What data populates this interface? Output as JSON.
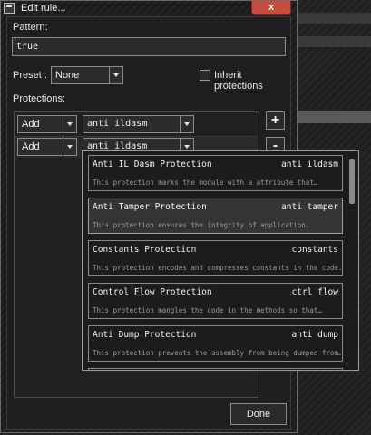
{
  "window": {
    "title": "Edit rule...",
    "close_glyph": "x"
  },
  "pattern": {
    "label": "Pattern:",
    "value": "true"
  },
  "preset": {
    "label": "Preset :",
    "value": "None"
  },
  "inherit": {
    "label": "Inherit protections",
    "checked": false
  },
  "protections": {
    "label": "Protections:",
    "rows": [
      {
        "action": "Add",
        "protection": "anti ildasm"
      },
      {
        "action": "Add",
        "protection": "anti ildasm"
      }
    ],
    "add_glyph": "+",
    "remove_glyph": "-"
  },
  "dropdown": {
    "items": [
      {
        "name": "Anti IL Dasm Protection",
        "id": "anti ildasm",
        "desc": "This protection marks the module with a attribute that…"
      },
      {
        "name": "Anti Tamper Protection",
        "id": "anti tamper",
        "desc": "This protection ensures the integrity of application."
      },
      {
        "name": "Constants Protection",
        "id": "constants",
        "desc": "This protection encodes and compresses constants in the code."
      },
      {
        "name": "Control Flow Protection",
        "id": "ctrl flow",
        "desc": "This protection mangles the code in the methods so that…"
      },
      {
        "name": "Anti Dump Protection",
        "id": "anti dump",
        "desc": "This protection prevents the assembly from being dumped from…"
      }
    ]
  },
  "done_label": "Done"
}
